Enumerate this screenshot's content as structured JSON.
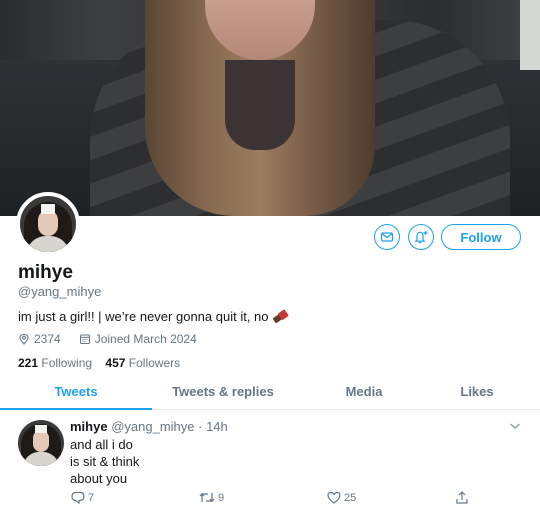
{
  "profile": {
    "name": "mihye",
    "handle": "@yang_mihye",
    "bio": "im just a girl!! | we’re never gonna quit it, no",
    "location": "2374",
    "joined": "Joined March 2024",
    "following_count": "221",
    "following_label": "Following",
    "followers_count": "457",
    "followers_label": "Followers",
    "follow_button": "Follow"
  },
  "tabs": [
    {
      "label": "Tweets",
      "active": true
    },
    {
      "label": "Tweets & replies",
      "active": false
    },
    {
      "label": "Media",
      "active": false
    },
    {
      "label": "Likes",
      "active": false
    }
  ],
  "tweet": {
    "name": "mihye",
    "handle": "@yang_mihye",
    "time": "14h",
    "lines": [
      "and all i do",
      "is sit & think",
      "about you"
    ],
    "replies": "7",
    "retweets": "9",
    "likes": "25"
  },
  "icons": {
    "message": "message-icon",
    "bell": "bell-add-icon",
    "location": "location-pin-icon",
    "calendar": "calendar-icon",
    "reply": "reply-icon",
    "retweet": "retweet-icon",
    "like": "heart-icon",
    "share": "share-icon",
    "chevron": "chevron-down-icon",
    "emoji": "chocolate-bar-emoji"
  },
  "colors": {
    "accent": "#1da1f2",
    "text": "#14171a",
    "muted": "#657786",
    "divider": "#e6ecf0"
  }
}
